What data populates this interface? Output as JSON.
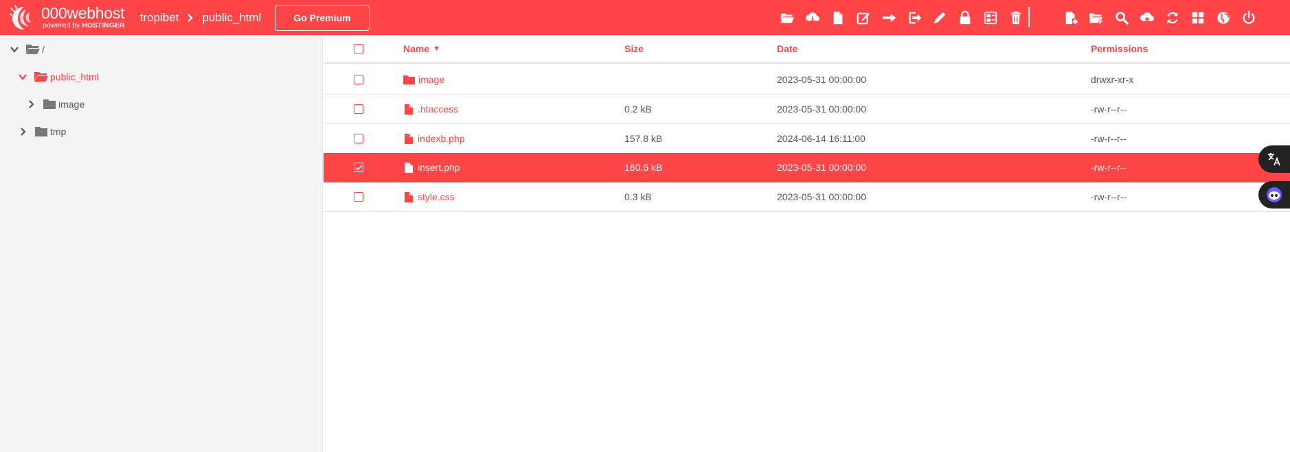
{
  "header": {
    "brand": "000webhost",
    "brand_sub_prefix": "powered by",
    "brand_sub_company": "HOSTINGER",
    "breadcrumbs": [
      "tropibet",
      "public_html"
    ],
    "premium_label": "Go Premium",
    "toolbar_left": [
      "folder-open-icon",
      "cloud-download-icon",
      "file-icon",
      "edit-icon",
      "move-arrow-icon",
      "export-icon",
      "rename-pencil-icon",
      "lock-icon",
      "archive-icon",
      "trash-icon"
    ],
    "toolbar_right": [
      "new-file-icon",
      "new-folder-icon",
      "search-icon",
      "upload-icon",
      "refresh-icon",
      "grid-icon",
      "globe-icon",
      "power-icon"
    ]
  },
  "sidebar": {
    "root": "/",
    "items": [
      {
        "label": "public_html",
        "expanded": true,
        "active": true
      },
      {
        "label": "image",
        "expanded": false,
        "active": false
      },
      {
        "label": "tmp",
        "expanded": false,
        "active": false
      }
    ]
  },
  "table": {
    "columns": {
      "name": "Name",
      "sort_indicator": "▼",
      "size": "Size",
      "date": "Date",
      "permissions": "Permissions"
    },
    "rows": [
      {
        "name": "image",
        "type": "folder",
        "size": "",
        "date": "2023-05-31 00:00:00",
        "permissions": "drwxr-xr-x",
        "selected": false
      },
      {
        "name": ".htaccess",
        "type": "file",
        "size": "0.2 kB",
        "date": "2023-05-31 00:00:00",
        "permissions": "-rw-r--r--",
        "selected": false
      },
      {
        "name": "indexb.php",
        "type": "file",
        "size": "157.8 kB",
        "date": "2024-06-14 16:11:00",
        "permissions": "-rw-r--r--",
        "selected": false
      },
      {
        "name": "insert.php",
        "type": "file",
        "size": "160.6 kB",
        "date": "2023-05-31 00:00:00",
        "permissions": "-rw-r--r--",
        "selected": true
      },
      {
        "name": "style.css",
        "type": "file",
        "size": "0.3 kB",
        "date": "2023-05-31 00:00:00",
        "permissions": "-rw-r--r--",
        "selected": false
      }
    ]
  },
  "floating": [
    "translate-icon",
    "assistant-icon"
  ],
  "colors": {
    "accent": "#ff4548",
    "sidebar_bg": "#f5f5f5",
    "text": "#555555"
  }
}
